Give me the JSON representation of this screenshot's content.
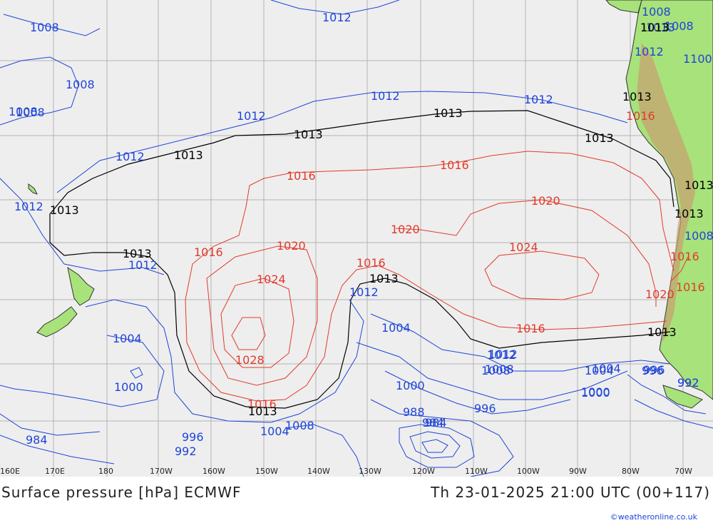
{
  "title_left": "Surface pressure [hPa] ECMWF",
  "title_right": "Th 23-01-2025 21:00 UTC (00+117)",
  "credit": "©weatheronline.co.uk",
  "longitude_labels": [
    "160E",
    "170E",
    "180",
    "170W",
    "160W",
    "150W",
    "140W",
    "130W",
    "120W",
    "110W",
    "100W",
    "90W",
    "80W",
    "70W"
  ],
  "isobar_labels": {
    "blue": [
      "1008",
      "1012",
      "1008",
      "1008",
      "1012",
      "1012",
      "1012",
      "1012",
      "1012",
      "1012",
      "1012",
      "1008",
      "1004",
      "1000",
      "1004",
      "1008",
      "1004",
      "1000",
      "996",
      "992",
      "984",
      "988",
      "984",
      "1008",
      "1004",
      "1000",
      "996",
      "1012",
      "1004",
      "1000",
      "996",
      "992",
      "1008",
      "1013",
      "1008",
      "1012",
      "1100",
      "1008",
      "984",
      "992",
      "996",
      "1012",
      "1008"
    ],
    "red": [
      "1016",
      "1016",
      "1016",
      "1016",
      "1020",
      "1020",
      "1020",
      "1024",
      "1024",
      "1028",
      "1016",
      "1016",
      "1020",
      "1016",
      "1016",
      "1016"
    ],
    "black": [
      "1013",
      "1013",
      "1013",
      "1013",
      "1013",
      "1013",
      "1013",
      "1013",
      "1013",
      "1013",
      "1013",
      "1013",
      "1013",
      "1013"
    ]
  },
  "colors": {
    "ocean": "#eeeeee",
    "land": "#a8e27a",
    "isobar_low": "#1f45d8",
    "isobar_high": "#e23a2a",
    "isobar_1013": "#000000",
    "grid": "#b0b0b0"
  }
}
